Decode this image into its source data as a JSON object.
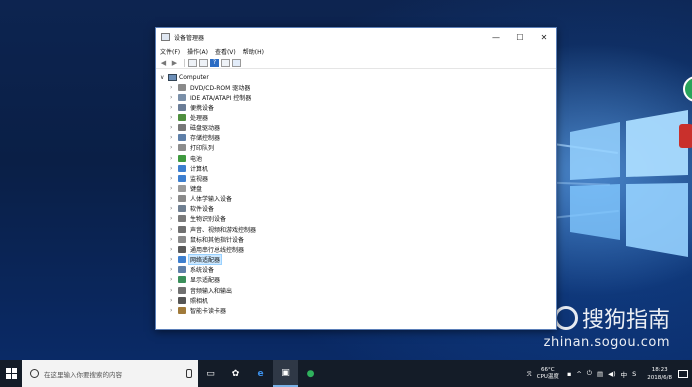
{
  "window": {
    "title": "设备管理器",
    "controls": {
      "minimize": "—",
      "maximize": "☐",
      "close": "✕"
    }
  },
  "menu": [
    "文件(F)",
    "操作(A)",
    "查看(V)",
    "帮助(H)"
  ],
  "toolbar": {
    "back": "◀",
    "forward": "▶",
    "help": "?"
  },
  "tree": {
    "root_label": "Computer",
    "root_caret": "∨",
    "collapsed_caret": "›",
    "items": [
      {
        "label": "DVD/CD-ROM 驱动器",
        "icon": "dvd-drive-icon",
        "color": "#8a8a8a"
      },
      {
        "label": "IDE ATA/ATAPI 控制器",
        "icon": "ide-controller-icon",
        "color": "#7a8fa8"
      },
      {
        "label": "便携设备",
        "icon": "portable-device-icon",
        "color": "#6a7c96"
      },
      {
        "label": "处理器",
        "icon": "processor-icon",
        "color": "#4f8f3f"
      },
      {
        "label": "磁盘驱动器",
        "icon": "disk-drive-icon",
        "color": "#777777"
      },
      {
        "label": "存储控制器",
        "icon": "storage-controller-icon",
        "color": "#5e7fa8"
      },
      {
        "label": "打印队列",
        "icon": "print-queue-icon",
        "color": "#8c8c8c"
      },
      {
        "label": "电池",
        "icon": "battery-icon",
        "color": "#3f9a3f"
      },
      {
        "label": "计算机",
        "icon": "computer-icon",
        "color": "#3d7fcf"
      },
      {
        "label": "监视器",
        "icon": "monitor-icon",
        "color": "#3d7fcf"
      },
      {
        "label": "键盘",
        "icon": "keyboard-icon",
        "color": "#9a9a9a"
      },
      {
        "label": "人体学输入设备",
        "icon": "hid-icon",
        "color": "#8a8a8a"
      },
      {
        "label": "软件设备",
        "icon": "software-device-icon",
        "color": "#6f7f91"
      },
      {
        "label": "生物识别设备",
        "icon": "biometric-icon",
        "color": "#7a7a7a"
      },
      {
        "label": "声音、视频和游戏控制器",
        "icon": "sound-icon",
        "color": "#707070"
      },
      {
        "label": "鼠标和其他指针设备",
        "icon": "mouse-icon",
        "color": "#8a8a8a"
      },
      {
        "label": "通用串行总线控制器",
        "icon": "usb-icon",
        "color": "#5a5a5a"
      },
      {
        "label": "网络适配器",
        "icon": "network-adapter-icon",
        "color": "#3d7fcf",
        "selected": true
      },
      {
        "label": "系统设备",
        "icon": "system-device-icon",
        "color": "#5e7fa8"
      },
      {
        "label": "显示适配器",
        "icon": "display-adapter-icon",
        "color": "#3a8f5a"
      },
      {
        "label": "音频输入和输出",
        "icon": "audio-io-icon",
        "color": "#707070"
      },
      {
        "label": "照相机",
        "icon": "camera-icon",
        "color": "#555555"
      },
      {
        "label": "智能卡读卡器",
        "icon": "smart-card-reader-icon",
        "color": "#a07a3a"
      }
    ]
  },
  "taskbar": {
    "search_placeholder": "在这里输入你要搜索的内容",
    "temperature": "66°C",
    "temperature_label": "CPU温度",
    "time": "18:23",
    "date": "2018/6/8",
    "ime": "中",
    "ime_mode": "S"
  },
  "watermark": {
    "brand": "搜狗指南",
    "url": "zhinan.sogou.com"
  }
}
